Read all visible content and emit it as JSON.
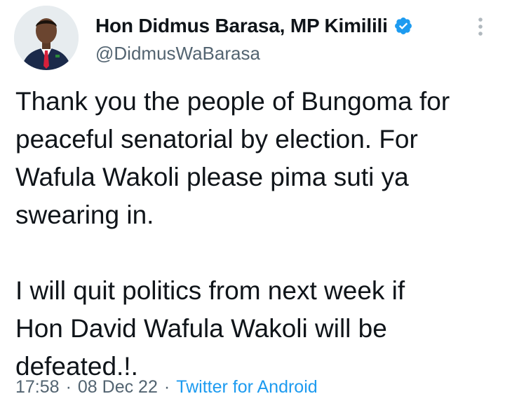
{
  "author": {
    "display_name": "Hon Didmus Barasa, MP Kimilili",
    "handle": "@DidmusWaBarasa",
    "verified": true,
    "avatar_icon": "profile-photo"
  },
  "tweet": {
    "paragraph1": "Thank you the people of Bungoma for\npeaceful senatorial by election. For\nWafula Wakoli please pima suti ya\nswearing in.",
    "paragraph2": "I will quit politics from next week if\nHon David Wafula Wakoli will be\ndefeated.!."
  },
  "meta": {
    "time": "17:58",
    "separator": "·",
    "date": "08 Dec 22",
    "source": "Twitter for Android"
  },
  "icons": {
    "verified": "verified-badge-icon",
    "more": "more-options-icon"
  },
  "colors": {
    "text": "#0f1419",
    "secondary": "#536471",
    "accent": "#1d9bf0"
  }
}
